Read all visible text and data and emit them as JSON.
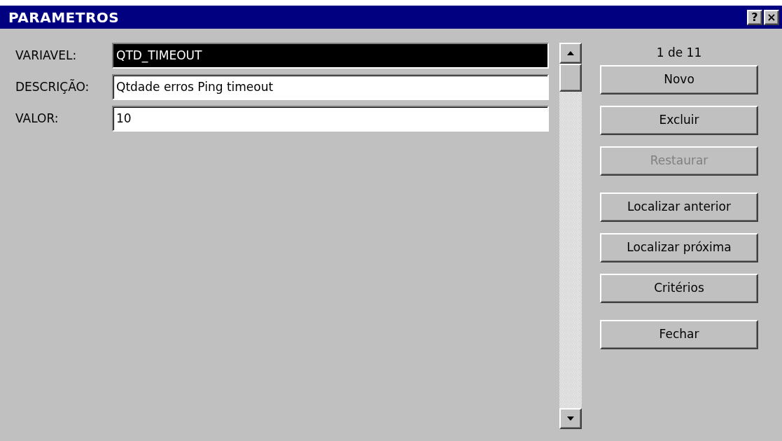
{
  "window": {
    "title": "PARAMETROS",
    "title_buttons": [
      "?",
      "×"
    ]
  },
  "fields": [
    {
      "label": "VARIAVEL:",
      "value": "QTD_TIMEOUT",
      "selected": true
    },
    {
      "label": "DESCRIÇÃO:",
      "value": "Qtdade erros Ping timeout",
      "selected": false
    },
    {
      "label": "VALOR:",
      "value": "10",
      "selected": false
    }
  ],
  "record_counter": "1 de 11",
  "button_groups": [
    [
      {
        "label": "Novo",
        "disabled": false
      },
      {
        "label": "Excluir",
        "disabled": false
      },
      {
        "label": "Restaurar",
        "disabled": true
      }
    ],
    [
      {
        "label": "Localizar anterior",
        "disabled": false
      },
      {
        "label": "Localizar próxima",
        "disabled": false
      },
      {
        "label": "Critérios",
        "disabled": false
      }
    ],
    [
      {
        "label": "Fechar",
        "disabled": false
      }
    ]
  ]
}
